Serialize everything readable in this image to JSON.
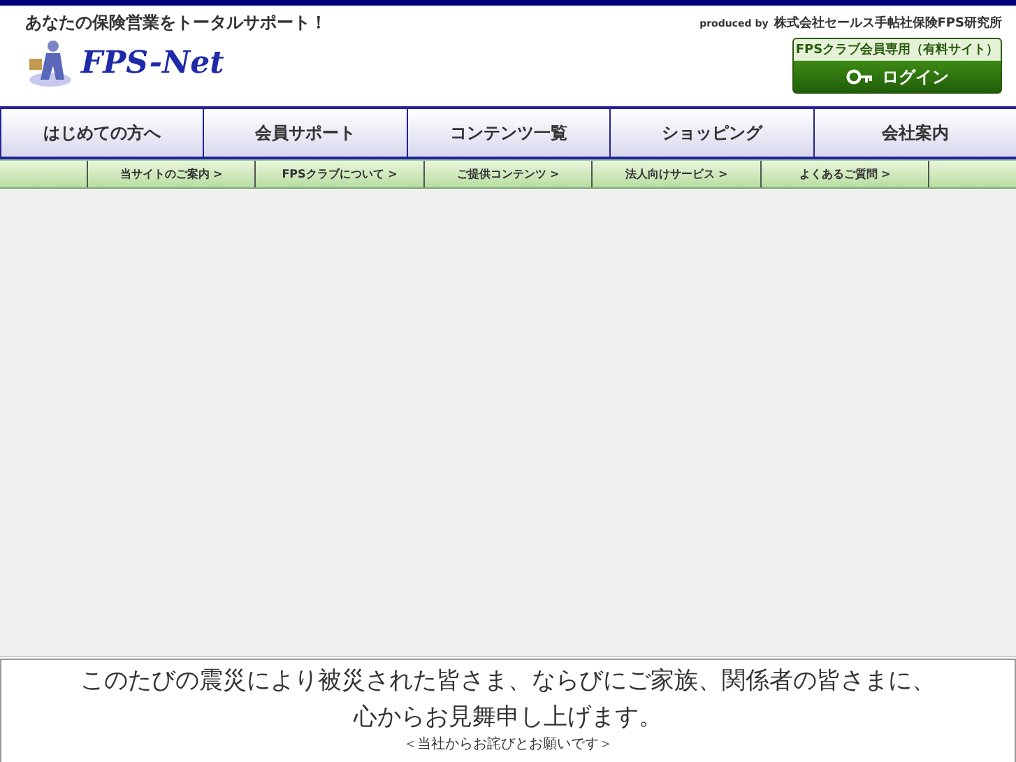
{
  "header": {
    "tagline": "あなたの保険営業をトータルサポート！",
    "logo": "FPS-Net",
    "produced_by": "produced by",
    "company": "株式会社セールス手帖社保険FPS研究所",
    "member_label": "FPSクラブ会員専用（有料サイト）",
    "login": "ログイン"
  },
  "main_nav": [
    "はじめての方へ",
    "会員サポート",
    "コンテンツ一覧",
    "ショッピング",
    "会社案内"
  ],
  "sub_nav": [
    "当サイトのご案内 >",
    "FPSクラブについて >",
    "ご提供コンテンツ >",
    "法人向けサービス >",
    "よくあるご質問 >"
  ],
  "notice": {
    "lines": [
      "このたびの震災により被災された皆さま、ならびにご家族、関係者の皆さまに、",
      "心からお見舞申し上げます。"
    ],
    "sub": "＜当社からお詫びとお願いです＞"
  }
}
